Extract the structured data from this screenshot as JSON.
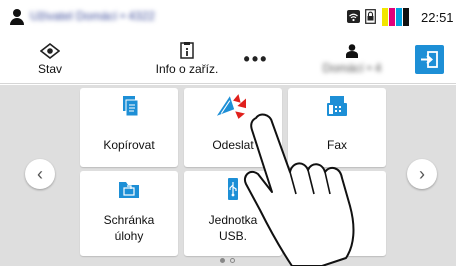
{
  "status_bar": {
    "user_name": "Uživatel Domácí • 4322",
    "time": "22:51",
    "icons": [
      "user-icon",
      "wifi-icon",
      "lock-icon",
      "toner-levels-icon"
    ],
    "toner_colors": [
      "#f2e600",
      "#e0007a",
      "#00a0e0",
      "#111111"
    ]
  },
  "toolbar": {
    "status_label": "Stav",
    "info_label": "Info o zaříz.",
    "more_label": "•••",
    "user_label": "Domácí • 4",
    "logout_icon": "logout-icon"
  },
  "navigation": {
    "prev": "‹",
    "next": "›"
  },
  "tiles": [
    {
      "label": "Kopírovat",
      "icon": "copy-icon"
    },
    {
      "label": "Odeslat",
      "icon": "send-icon"
    },
    {
      "label": "Fax",
      "icon": "fax-icon"
    },
    {
      "label_line1": "Schránka",
      "label_line2": "úlohy",
      "icon": "job-box-icon"
    },
    {
      "label_line1": "Jednotka",
      "label_line2": "USB.",
      "icon": "usb-drive-icon"
    },
    {
      "label": "",
      "icon": ""
    }
  ],
  "page_indicator": {
    "pages": 2,
    "current": 1
  },
  "colors": {
    "accent": "#1d8fd6",
    "background": "#dedede",
    "tile": "#ffffff",
    "tap": "#e0201c"
  }
}
